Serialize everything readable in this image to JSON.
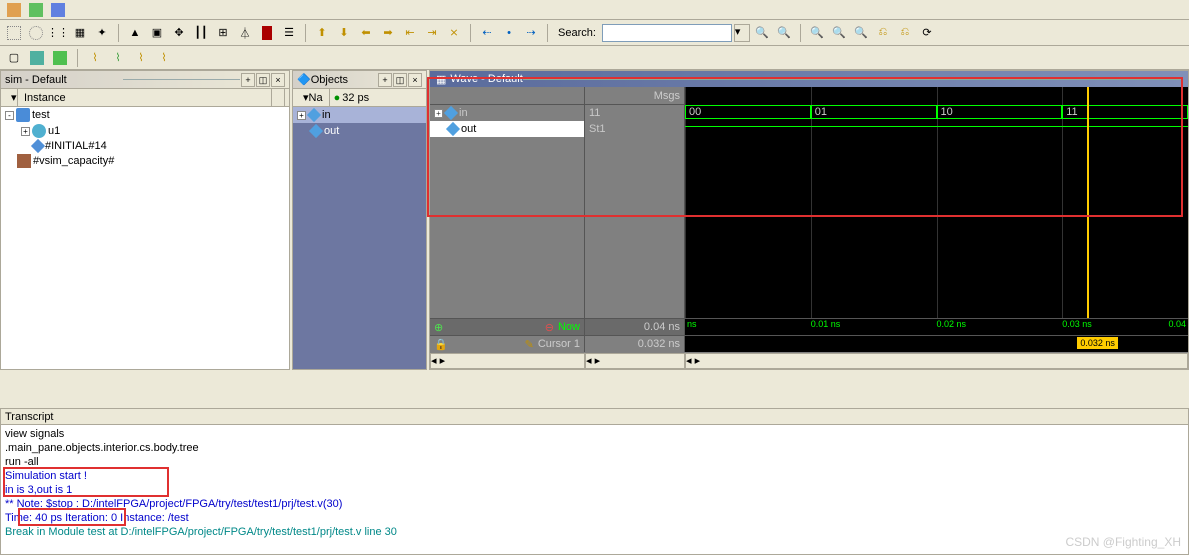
{
  "toolbar": {
    "search_label": "Search:"
  },
  "sim_panel": {
    "title": "sim - Default",
    "header_col": "Instance",
    "tree": [
      {
        "name": "test",
        "depth": 0,
        "exp": "-",
        "icon": "blue"
      },
      {
        "name": "u1",
        "depth": 1,
        "exp": "+",
        "icon": "teal"
      },
      {
        "name": "#INITIAL#14",
        "depth": 1,
        "exp": "",
        "icon": "diamond"
      },
      {
        "name": "#vsim_capacity#",
        "depth": 0,
        "exp": "",
        "icon": "wave"
      }
    ]
  },
  "obj_panel": {
    "title": "Objects",
    "header": "Na",
    "time_badge": "32 ps",
    "items": [
      {
        "name": "in",
        "exp": "+",
        "sel": true
      },
      {
        "name": "out",
        "exp": "",
        "sel": false
      }
    ]
  },
  "wave_panel": {
    "title": "Wave - Default",
    "msgs_label": "Msgs",
    "signals": [
      {
        "name": "in",
        "value": "11",
        "exp": "+",
        "sel": false
      },
      {
        "name": "out",
        "value": "St1",
        "exp": "",
        "sel": true
      }
    ],
    "bus_segments": [
      "00",
      "01",
      "10",
      "11"
    ],
    "now_label": "Now",
    "now_value": "0.04 ns",
    "cursor_label": "Cursor 1",
    "cursor_value": "0.032 ns",
    "ruler": [
      "ns",
      "0.01 ns",
      "0.02 ns",
      "0.03 ns",
      "0.04"
    ],
    "cursor_indicator": "0.032 ns"
  },
  "transcript": {
    "title": "Transcript",
    "lines": [
      {
        "cls": "t-black",
        "text": "view signals"
      },
      {
        "cls": "t-black",
        "text": ".main_pane.objects.interior.cs.body.tree"
      },
      {
        "cls": "t-black",
        "text": "run -all"
      },
      {
        "cls": "t-blue",
        "text": "Simulation start !"
      },
      {
        "cls": "t-blue",
        "text": "in is 3,out is 1"
      },
      {
        "cls": "t-blue",
        "text": "** Note: $stop    : D:/intelFPGA/project/FPGA/try/test/test1/prj/test.v(30)"
      },
      {
        "cls": "t-blue",
        "text": "   Time: 40 ps  Iteration: 0  Instance: /test"
      },
      {
        "cls": "t-teal",
        "text": "Break in Module test at D:/intelFPGA/project/FPGA/try/test/test1/prj/test.v line 30"
      }
    ]
  },
  "watermark": "CSDN @Fighting_XH"
}
